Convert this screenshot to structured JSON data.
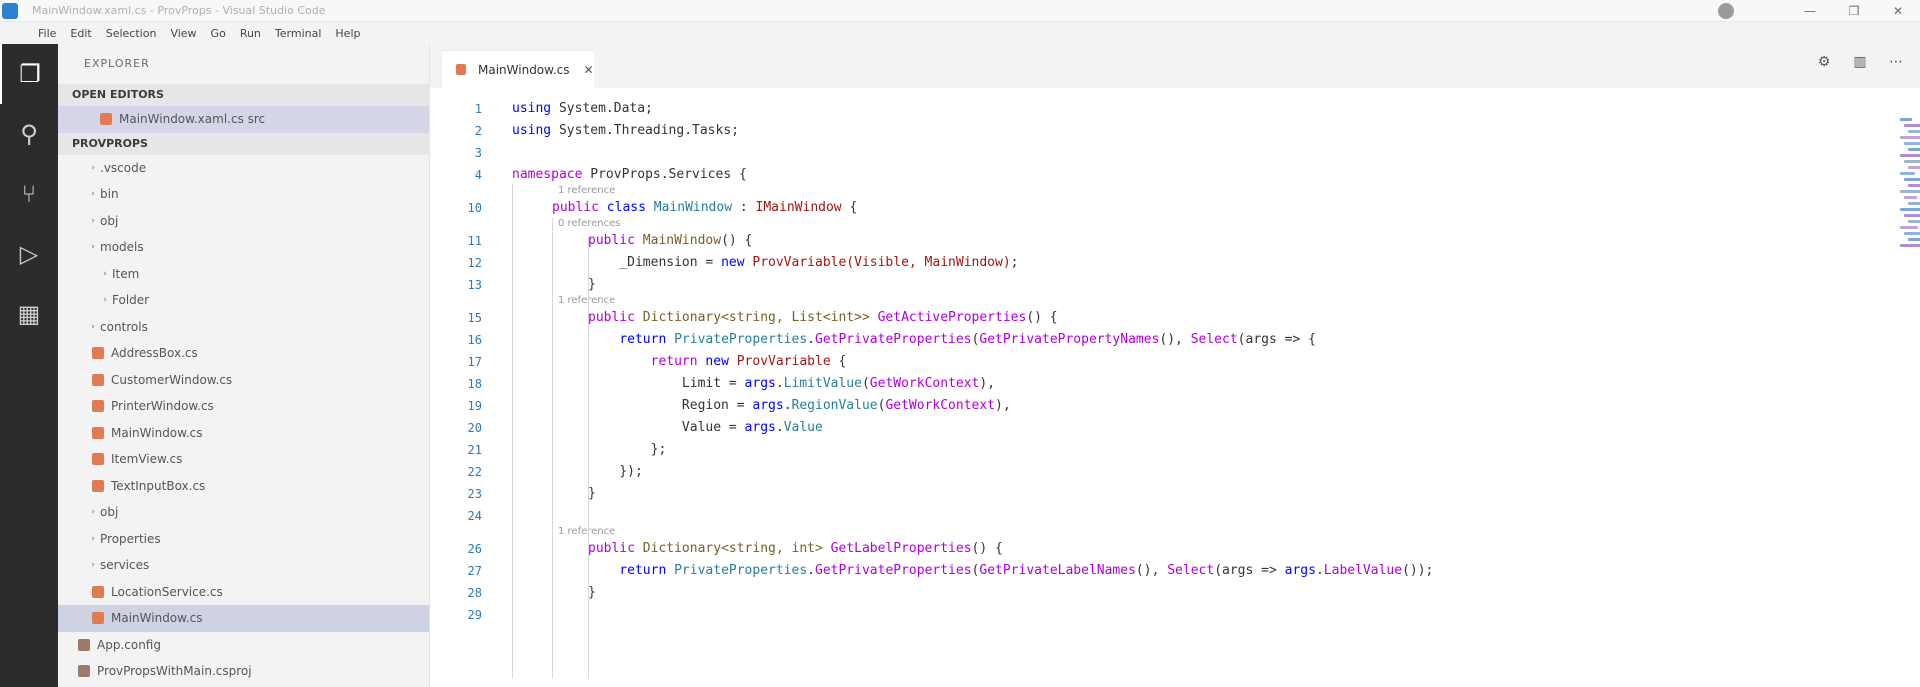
{
  "window": {
    "title": "MainWindow.xaml.cs - ProvProps - Visual Studio Code",
    "controls": [
      "—",
      "❐",
      "✕"
    ]
  },
  "menu": [
    "File",
    "Edit",
    "Selection",
    "View",
    "Go",
    "Run",
    "Terminal",
    "Help"
  ],
  "activity_bar": [
    {
      "name": "explorer",
      "glyph": "❐"
    },
    {
      "name": "search",
      "glyph": "⚲"
    },
    {
      "name": "source-control",
      "glyph": "⑂"
    },
    {
      "name": "run-debug",
      "glyph": "▷"
    },
    {
      "name": "extensions",
      "glyph": "▦"
    }
  ],
  "sidebar": {
    "title": "EXPLORER",
    "open_editors_header": "OPEN EDITORS",
    "open_editors": [
      {
        "label": "MainWindow.xaml.cs  src",
        "selected": true
      }
    ],
    "project_header": "PROVPROPS",
    "items": [
      {
        "label": ".vscode",
        "type": "folder",
        "depth": 1
      },
      {
        "label": "bin",
        "type": "folder",
        "depth": 1
      },
      {
        "label": "obj",
        "type": "folder",
        "depth": 1
      },
      {
        "label": "models",
        "type": "folder",
        "depth": 1
      },
      {
        "label": "Item",
        "type": "folder",
        "depth": 2
      },
      {
        "label": "Folder",
        "type": "folder",
        "depth": 2
      },
      {
        "label": "controls",
        "type": "folder",
        "depth": 1
      },
      {
        "label": "AddressBox.cs",
        "type": "file",
        "depth": 1
      },
      {
        "label": "CustomerWindow.cs",
        "type": "file",
        "depth": 1
      },
      {
        "label": "PrinterWindow.cs",
        "type": "file",
        "depth": 1
      },
      {
        "label": "MainWindow.cs",
        "type": "file",
        "depth": 1
      },
      {
        "label": "ItemView.cs",
        "type": "file",
        "depth": 1
      },
      {
        "label": "TextInputBox.cs",
        "type": "file",
        "depth": 1
      },
      {
        "label": "obj",
        "type": "folder",
        "depth": 1
      },
      {
        "label": "Properties",
        "type": "folder",
        "depth": 1
      },
      {
        "label": "services",
        "type": "folder",
        "depth": 1
      },
      {
        "label": "LocationService.cs",
        "type": "file",
        "depth": 1
      },
      {
        "label": "MainWindow.cs",
        "type": "file",
        "depth": 1,
        "active": true
      },
      {
        "label": "App.config",
        "type": "config",
        "depth": 0
      },
      {
        "label": "ProvPropsWithMain.csproj",
        "type": "config",
        "depth": 0
      }
    ]
  },
  "editor": {
    "tab_label": "MainWindow.cs",
    "tab_close": "✕",
    "actions": [
      "⚙",
      "▥",
      "⋯"
    ],
    "lines": [
      {
        "n": "1",
        "tokens": [
          [
            "kw",
            "using"
          ],
          [
            "pl",
            " System.Data;"
          ]
        ]
      },
      {
        "n": "2",
        "tokens": [
          [
            "kw",
            "using"
          ],
          [
            "pl",
            " System.Threading.Tasks;"
          ]
        ]
      },
      {
        "n": "3",
        "tokens": []
      },
      {
        "n": "4",
        "tokens": [
          [
            "kw2",
            "namespace"
          ],
          [
            "pl",
            " ProvProps.Services {"
          ]
        ]
      },
      {
        "n": "",
        "lens": "1 reference"
      },
      {
        "n": "10",
        "tokens": [
          [
            "kw2",
            "public"
          ],
          [
            "pl",
            " "
          ],
          [
            "kw",
            "class"
          ],
          [
            "pl",
            " "
          ],
          [
            "ty",
            "MainWindow"
          ],
          [
            "pl",
            " : "
          ],
          [
            "st",
            "IMainWindow"
          ],
          [
            "pl",
            " {"
          ]
        ]
      },
      {
        "n": "",
        "lens": "0 references"
      },
      {
        "n": "11",
        "tokens": [
          [
            "kw2",
            "public"
          ],
          [
            "pl",
            " "
          ],
          [
            "fn",
            "MainWindow"
          ],
          [
            "pl",
            "() {"
          ]
        ]
      },
      {
        "n": "12",
        "tokens": [
          [
            "pl",
            "    _Dimension = "
          ],
          [
            "kw",
            "new"
          ],
          [
            "pl",
            " "
          ],
          [
            "st",
            "ProvVariable(Visible, MainWindow)"
          ],
          [
            "pl",
            ";"
          ]
        ]
      },
      {
        "n": "13",
        "tokens": [
          [
            "pl",
            "}"
          ]
        ]
      },
      {
        "n": "",
        "lens": "1 reference"
      },
      {
        "n": "15",
        "tokens": [
          [
            "kw2",
            "public"
          ],
          [
            "pl",
            " "
          ],
          [
            "fn",
            "Dictionary<string, List<int>>"
          ],
          [
            "pl",
            " "
          ],
          [
            "kw2",
            "GetActiveProperties"
          ],
          [
            "pl",
            "() {"
          ]
        ]
      },
      {
        "n": "16",
        "tokens": [
          [
            "pl",
            "    "
          ],
          [
            "kw",
            "return"
          ],
          [
            "pl",
            " "
          ],
          [
            "ty",
            "PrivateProperties"
          ],
          [
            "pl",
            "."
          ],
          [
            "kw2",
            "GetPrivateProperties"
          ],
          [
            "pl",
            "("
          ],
          [
            "kw2",
            "GetPrivatePropertyNames"
          ],
          [
            "pl",
            "(), "
          ],
          [
            "kw2",
            "Select"
          ],
          [
            "pl",
            "(args => {"
          ]
        ]
      },
      {
        "n": "17",
        "tokens": [
          [
            "pl",
            "        "
          ],
          [
            "kw2",
            "return"
          ],
          [
            "pl",
            " "
          ],
          [
            "kw",
            "new"
          ],
          [
            "pl",
            " "
          ],
          [
            "st",
            "ProvVariable"
          ],
          [
            "pl",
            " {"
          ]
        ]
      },
      {
        "n": "18",
        "tokens": [
          [
            "pl",
            "            Limit = "
          ],
          [
            "kw",
            "args"
          ],
          [
            "pl",
            "."
          ],
          [
            "ty",
            "LimitValue"
          ],
          [
            "pl",
            "("
          ],
          [
            "kw2",
            "GetWorkContext"
          ],
          [
            "pl",
            "),"
          ]
        ]
      },
      {
        "n": "19",
        "tokens": [
          [
            "pl",
            "            Region = "
          ],
          [
            "kw",
            "args"
          ],
          [
            "pl",
            "."
          ],
          [
            "ty",
            "RegionValue"
          ],
          [
            "pl",
            "("
          ],
          [
            "kw2",
            "GetWorkContext"
          ],
          [
            "pl",
            "),"
          ]
        ]
      },
      {
        "n": "20",
        "tokens": [
          [
            "pl",
            "            Value = "
          ],
          [
            "kw",
            "args"
          ],
          [
            "pl",
            "."
          ],
          [
            "ty",
            "Value"
          ]
        ]
      },
      {
        "n": "21",
        "tokens": [
          [
            "pl",
            "        };"
          ]
        ]
      },
      {
        "n": "22",
        "tokens": [
          [
            "pl",
            "    });"
          ]
        ]
      },
      {
        "n": "23",
        "tokens": [
          [
            "pl",
            "}"
          ]
        ]
      },
      {
        "n": "24",
        "tokens": []
      },
      {
        "n": "",
        "lens": "1 reference"
      },
      {
        "n": "26",
        "tokens": [
          [
            "kw2",
            "public"
          ],
          [
            "pl",
            " "
          ],
          [
            "fn",
            "Dictionary<string, int>"
          ],
          [
            "pl",
            " "
          ],
          [
            "kw2",
            "GetLabelProperties"
          ],
          [
            "pl",
            "() {"
          ]
        ]
      },
      {
        "n": "27",
        "tokens": [
          [
            "pl",
            "    "
          ],
          [
            "kw",
            "return"
          ],
          [
            "pl",
            " "
          ],
          [
            "ty",
            "PrivateProperties"
          ],
          [
            "pl",
            "."
          ],
          [
            "kw2",
            "GetPrivateProperties"
          ],
          [
            "pl",
            "("
          ],
          [
            "kw2",
            "GetPrivateLabelNames"
          ],
          [
            "pl",
            "(), "
          ],
          [
            "kw2",
            "Select"
          ],
          [
            "pl",
            "(args => "
          ],
          [
            "kw",
            "args"
          ],
          [
            "pl",
            "."
          ],
          [
            "kw2",
            "LabelValue"
          ],
          [
            "pl",
            "());"
          ]
        ]
      },
      {
        "n": "28",
        "tokens": [
          [
            "pl",
            "}"
          ]
        ]
      },
      {
        "n": "29",
        "tokens": []
      }
    ]
  }
}
